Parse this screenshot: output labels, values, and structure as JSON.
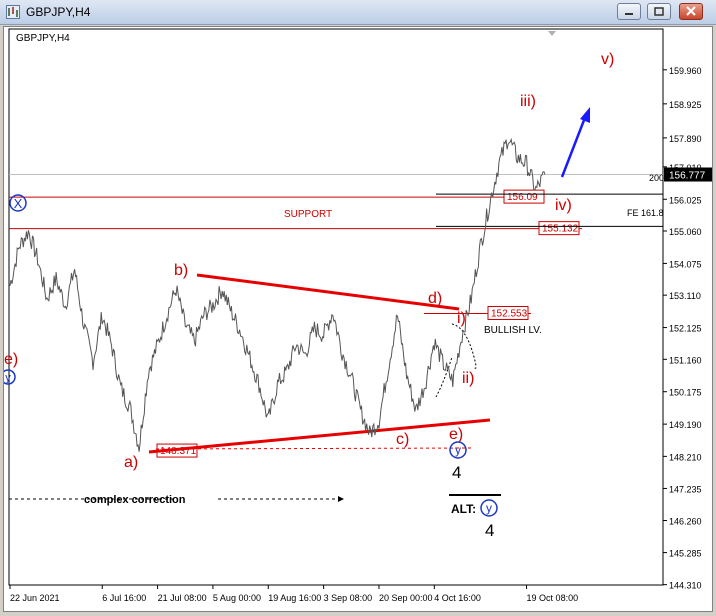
{
  "window": {
    "title": "GBPJPY,H4",
    "symbol_label": "GBPJPY,H4",
    "minimize_icon": "minimize-icon",
    "restore_icon": "restore-icon",
    "close_icon": "close-icon"
  },
  "chart_data": {
    "type": "line",
    "price_axis": {
      "ylim": [
        144.3,
        161.2
      ],
      "ticks": [
        "159.960",
        "158.925",
        "157.890",
        "157.010",
        "156.025",
        "155.060",
        "154.075",
        "153.110",
        "152.125",
        "151.160",
        "150.175",
        "149.190",
        "148.210",
        "147.235",
        "146.260",
        "145.285",
        "144.310"
      ]
    },
    "time_axis": {
      "labels": [
        "22 Jun 2021",
        "6 Jul 16:00",
        "21 Jul 08:00",
        "5 Aug 00:00",
        "19 Aug 16:00",
        "3 Sep 08:00",
        "20 Sep 00:00",
        "4 Oct 16:00",
        "19 Oct 08:00"
      ]
    },
    "current_price": "156.777",
    "price_series": [
      {
        "t": "22 Jun 2021",
        "p": 153.4
      },
      {
        "p": 154.6
      },
      {
        "p": 155.05
      },
      {
        "p": 154.2
      },
      {
        "p": 153.0
      },
      {
        "p": 153.6
      },
      {
        "p": 152.8
      },
      {
        "p": 153.9
      },
      {
        "p": 152.2
      },
      {
        "p": 151.1
      },
      {
        "t": "6 Jul 16:00",
        "p": 152.5
      },
      {
        "p": 151.6
      },
      {
        "p": 150.3
      },
      {
        "p": 149.7
      },
      {
        "p": 148.5
      },
      {
        "p": 150.8
      },
      {
        "t": "21 Jul 08:00",
        "p": 151.6
      },
      {
        "p": 152.5
      },
      {
        "p": 153.3
      },
      {
        "p": 152.2
      },
      {
        "p": 151.7
      },
      {
        "p": 152.5
      },
      {
        "t": "5 Aug 00:00",
        "p": 152.8
      },
      {
        "p": 153.3
      },
      {
        "p": 152.6
      },
      {
        "p": 152.0
      },
      {
        "p": 151.2
      },
      {
        "p": 150.4
      },
      {
        "t": "19 Aug 16:00",
        "p": 149.3
      },
      {
        "p": 150.4
      },
      {
        "p": 150.8
      },
      {
        "p": 151.6
      },
      {
        "p": 151.3
      },
      {
        "p": 152.1
      },
      {
        "t": "3 Sep 08:00",
        "p": 151.9
      },
      {
        "p": 152.6
      },
      {
        "p": 151.4
      },
      {
        "p": 150.6
      },
      {
        "p": 149.6
      },
      {
        "p": 148.9
      },
      {
        "t": "20 Sep 00:00",
        "p": 149.3
      },
      {
        "p": 150.9
      },
      {
        "p": 152.5
      },
      {
        "p": 150.7
      },
      {
        "p": 149.6
      },
      {
        "p": 150.4
      },
      {
        "t": "4 Oct 16:00",
        "p": 151.7
      },
      {
        "p": 151.0
      },
      {
        "p": 150.5
      },
      {
        "p": 151.9
      },
      {
        "p": 153.0
      },
      {
        "p": 154.6
      },
      {
        "p": 155.9
      },
      {
        "p": 157.1
      },
      {
        "p": 157.9
      },
      {
        "p": 157.3
      },
      {
        "t": "19 Oct 08:00",
        "p": 157.1
      },
      {
        "p": 156.3
      },
      {
        "p": 156.777
      }
    ],
    "horizontal_levels": [
      {
        "price": 156.09,
        "label": "156.09",
        "color": "#cc0000"
      },
      {
        "price": 155.132,
        "label": "155.132",
        "color": "#cc0000",
        "note": "SUPPORT"
      },
      {
        "price": 152.553,
        "label": "152.553",
        "color": "#cc0000"
      },
      {
        "price": 148.371,
        "label": "148.371",
        "color": "#cc0000"
      },
      {
        "price": 156.18,
        "note": "200",
        "color": "#000000"
      },
      {
        "price": 155.2,
        "note": "FE 161.8",
        "color": "#000000"
      }
    ],
    "wave_labels": {
      "X": "X",
      "e_left": "e)",
      "y_left": "y",
      "a": "a)",
      "b": "b)",
      "c": "c)",
      "d": "d)",
      "e": "e)",
      "y": "y",
      "four": "4",
      "alt": "ALT:",
      "alt_y": "y",
      "alt_four": "4",
      "i": "i)",
      "ii": "ii)",
      "iii": "iii)",
      "iv": "iv)",
      "v": "v)"
    },
    "annotations": {
      "support": "SUPPORT",
      "bullish": "BULLISH LV.",
      "complex_correction": "complex correction",
      "fe": "FE 161.8",
      "ma": "200"
    },
    "colors": {
      "price": "#555555",
      "wave_red": "#cc0000",
      "wave_blue": "#1a37c8",
      "trendline": "#e60000",
      "arrow": "#1a1aff"
    }
  }
}
